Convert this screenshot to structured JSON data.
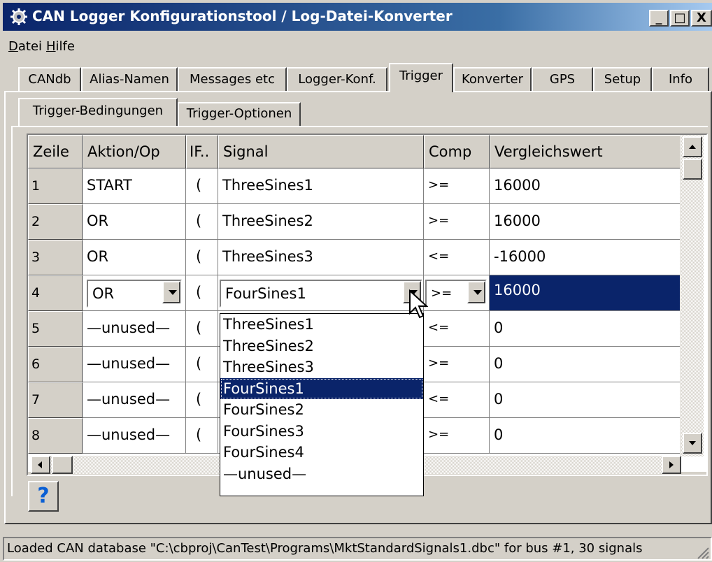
{
  "window": {
    "title": "CAN Logger Konfigurationstool / Log-Datei-Konverter",
    "minimize": "_",
    "maximize": "□",
    "close": "X"
  },
  "menu": [
    {
      "label_first": "D",
      "label_rest": "atei"
    },
    {
      "label_first": "H",
      "label_rest": "ilfe"
    }
  ],
  "tabs": [
    "CANdb",
    "Alias-Namen",
    "Messages etc",
    "Logger-Konf.",
    "Trigger",
    "Konverter",
    "GPS",
    "Setup",
    "Info"
  ],
  "active_tab": "Trigger",
  "subtabs": [
    "Trigger-Bedingungen",
    "Trigger-Optionen"
  ],
  "active_subtab": "Trigger-Bedingungen",
  "grid": {
    "headers": [
      "Zeile",
      "Aktion/Op",
      "IF..",
      "Signal",
      "Comp",
      "Vergleichswert"
    ],
    "rows": [
      {
        "zeile": "1",
        "aktion": "START",
        "if": "(",
        "signal": "ThreeSines1",
        "comp": ">=",
        "wert": "16000"
      },
      {
        "zeile": "2",
        "aktion": "OR",
        "if": "(",
        "signal": "ThreeSines2",
        "comp": ">=",
        "wert": "16000"
      },
      {
        "zeile": "3",
        "aktion": "OR",
        "if": "(",
        "signal": "ThreeSines3",
        "comp": "<=",
        "wert": "-16000"
      },
      {
        "zeile": "4",
        "aktion": "OR",
        "if": "(",
        "signal": "FourSines1",
        "comp": ">=",
        "wert": "16000"
      },
      {
        "zeile": "5",
        "aktion": "—unused—",
        "if": "(",
        "signal": "",
        "comp": "<=",
        "wert": "0"
      },
      {
        "zeile": "6",
        "aktion": "—unused—",
        "if": "(",
        "signal": "",
        "comp": ">=",
        "wert": "0"
      },
      {
        "zeile": "7",
        "aktion": "—unused—",
        "if": "(",
        "signal": "",
        "comp": "<=",
        "wert": "0"
      },
      {
        "zeile": "8",
        "aktion": "—unused—",
        "if": "(",
        "signal": "",
        "comp": ">=",
        "wert": "0"
      }
    ]
  },
  "dropdown": {
    "options": [
      "ThreeSines1",
      "ThreeSines2",
      "ThreeSines3",
      "FourSines1",
      "FourSines2",
      "FourSines3",
      "FourSines4",
      "—unused—"
    ],
    "selected": "FourSines1"
  },
  "help_button": "?",
  "status": "Loaded CAN database \"C:\\cbproj\\CanTest\\Programs\\MktStandardSignals1.dbc\" for bus #1, 30 signals",
  "colors": {
    "titlebar": "#0a246a",
    "selection": "#0a246a",
    "face": "#d4d0c8"
  }
}
